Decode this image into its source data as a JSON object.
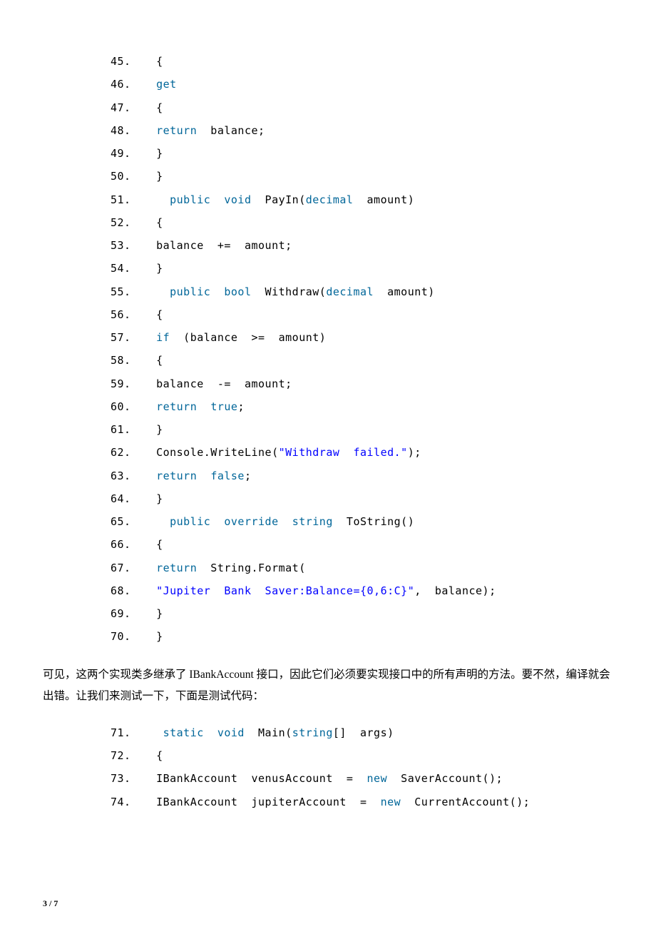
{
  "code1": [
    {
      "n": "45.",
      "tokens": [
        [
          "txt",
          "{"
        ]
      ]
    },
    {
      "n": "46.",
      "tokens": [
        [
          "kw",
          "get"
        ]
      ]
    },
    {
      "n": "47.",
      "tokens": [
        [
          "txt",
          "{"
        ]
      ]
    },
    {
      "n": "48.",
      "tokens": [
        [
          "kw",
          "return"
        ],
        [
          "txt",
          "  balance;"
        ]
      ]
    },
    {
      "n": "49.",
      "tokens": [
        [
          "txt",
          "}"
        ]
      ]
    },
    {
      "n": "50.",
      "tokens": [
        [
          "txt",
          "}"
        ]
      ]
    },
    {
      "n": "51.",
      "tokens": [
        [
          "txt",
          "  "
        ],
        [
          "kw",
          "public"
        ],
        [
          "txt",
          "  "
        ],
        [
          "kw",
          "void"
        ],
        [
          "txt",
          "  PayIn("
        ],
        [
          "type",
          "decimal"
        ],
        [
          "txt",
          "  amount)"
        ]
      ]
    },
    {
      "n": "52.",
      "tokens": [
        [
          "txt",
          "{"
        ]
      ]
    },
    {
      "n": "53.",
      "tokens": [
        [
          "txt",
          "balance  +=  amount;"
        ]
      ]
    },
    {
      "n": "54.",
      "tokens": [
        [
          "txt",
          "}"
        ]
      ]
    },
    {
      "n": "55.",
      "tokens": [
        [
          "txt",
          "  "
        ],
        [
          "kw",
          "public"
        ],
        [
          "txt",
          "  "
        ],
        [
          "kw",
          "bool"
        ],
        [
          "txt",
          "  Withdraw("
        ],
        [
          "type",
          "decimal"
        ],
        [
          "txt",
          "  amount)"
        ]
      ]
    },
    {
      "n": "56.",
      "tokens": [
        [
          "txt",
          "{"
        ]
      ]
    },
    {
      "n": "57.",
      "tokens": [
        [
          "kw",
          "if"
        ],
        [
          "txt",
          "  (balance  >=  amount)"
        ]
      ]
    },
    {
      "n": "58.",
      "tokens": [
        [
          "txt",
          "{"
        ]
      ]
    },
    {
      "n": "59.",
      "tokens": [
        [
          "txt",
          "balance  -=  amount;"
        ]
      ]
    },
    {
      "n": "60.",
      "tokens": [
        [
          "kw",
          "return"
        ],
        [
          "txt",
          "  "
        ],
        [
          "kw",
          "true"
        ],
        [
          "txt",
          ";"
        ]
      ]
    },
    {
      "n": "61.",
      "tokens": [
        [
          "txt",
          "}"
        ]
      ]
    },
    {
      "n": "62.",
      "tokens": [
        [
          "txt",
          "Console.WriteLine("
        ],
        [
          "str",
          "\"Withdraw  failed.\""
        ],
        [
          "txt",
          ");"
        ]
      ]
    },
    {
      "n": "63.",
      "tokens": [
        [
          "kw",
          "return"
        ],
        [
          "txt",
          "  "
        ],
        [
          "kw",
          "false"
        ],
        [
          "txt",
          ";"
        ]
      ]
    },
    {
      "n": "64.",
      "tokens": [
        [
          "txt",
          "}"
        ]
      ]
    },
    {
      "n": "65.",
      "tokens": [
        [
          "txt",
          "  "
        ],
        [
          "kw",
          "public"
        ],
        [
          "txt",
          "  "
        ],
        [
          "kw",
          "override"
        ],
        [
          "txt",
          "  "
        ],
        [
          "kw",
          "string"
        ],
        [
          "txt",
          "  ToString()"
        ]
      ]
    },
    {
      "n": "66.",
      "tokens": [
        [
          "txt",
          "{"
        ]
      ]
    },
    {
      "n": "67.",
      "tokens": [
        [
          "kw",
          "return"
        ],
        [
          "txt",
          "  String.Format("
        ]
      ]
    },
    {
      "n": "68.",
      "tokens": [
        [
          "str",
          "\"Jupiter  Bank  Saver:Balance={0,6:C}\""
        ],
        [
          "txt",
          ",  balance);"
        ]
      ]
    },
    {
      "n": "69.",
      "tokens": [
        [
          "txt",
          "}"
        ]
      ]
    },
    {
      "n": "70.",
      "tokens": [
        [
          "txt",
          "}"
        ]
      ]
    }
  ],
  "paragraph": "可见，这两个实现类多继承了 IBankAccount 接口，因此它们必须要实现接口中的所有声明的方法。要不然，编译就会出错。让我们来测试一下，下面是测试代码：",
  "code2": [
    {
      "n": "71.",
      "tokens": [
        [
          "txt",
          " "
        ],
        [
          "kw",
          "static"
        ],
        [
          "txt",
          "  "
        ],
        [
          "kw",
          "void"
        ],
        [
          "txt",
          "  Main("
        ],
        [
          "kw",
          "string"
        ],
        [
          "txt",
          "[]  args)"
        ]
      ]
    },
    {
      "n": "72.",
      "tokens": [
        [
          "txt",
          "{"
        ]
      ]
    },
    {
      "n": "73.",
      "tokens": [
        [
          "txt",
          "IBankAccount  venusAccount  =  "
        ],
        [
          "kw",
          "new"
        ],
        [
          "txt",
          "  SaverAccount();"
        ]
      ]
    },
    {
      "n": "74.",
      "tokens": [
        [
          "txt",
          "IBankAccount  jupiterAccount  =  "
        ],
        [
          "kw",
          "new"
        ],
        [
          "txt",
          "  CurrentAccount();"
        ]
      ]
    }
  ],
  "footer": {
    "current": "3",
    "sep": " / ",
    "total": "7"
  }
}
